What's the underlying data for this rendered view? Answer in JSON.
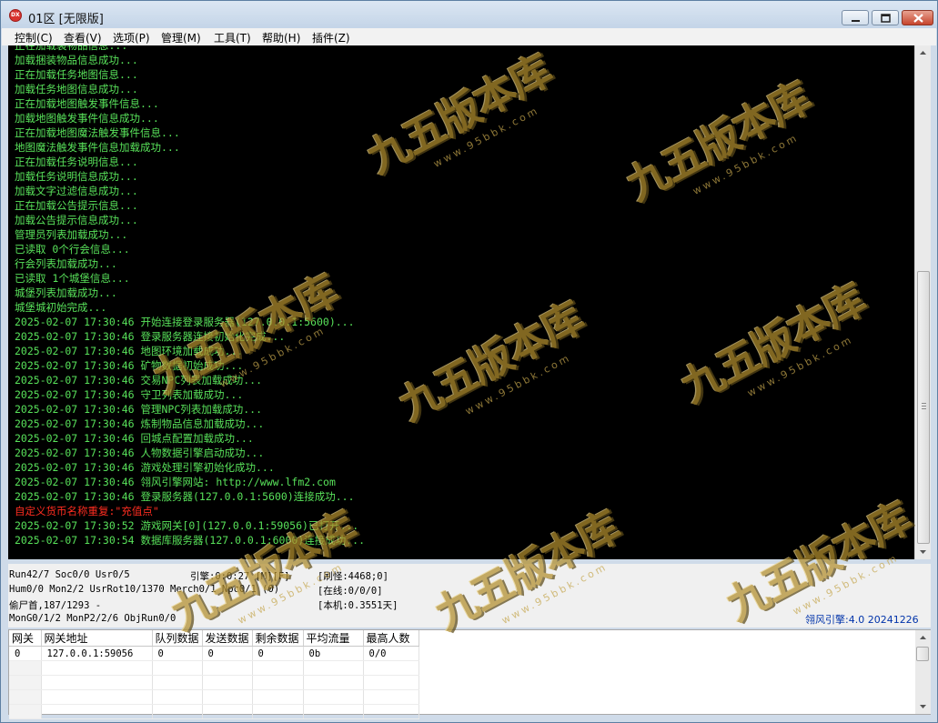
{
  "window": {
    "title": "01区 [无限版]"
  },
  "menu": [
    "控制(C)",
    "查看(V)",
    "选项(P)",
    "管理(M)",
    "工具(T)",
    "帮助(H)",
    "插件(Z)"
  ],
  "log": {
    "lines": [
      {
        "text": "正在加载装物品信息...",
        "style": "green"
      },
      {
        "text": "加载捆装物品信息成功...",
        "style": "green"
      },
      {
        "text": "正在加载任务地图信息...",
        "style": "green"
      },
      {
        "text": "加载任务地图信息成功...",
        "style": "green"
      },
      {
        "text": "正在加载地图触发事件信息...",
        "style": "green"
      },
      {
        "text": "加载地图触发事件信息成功...",
        "style": "green"
      },
      {
        "text": "正在加载地图魔法触发事件信息...",
        "style": "green"
      },
      {
        "text": "地图魔法触发事件信息加载成功...",
        "style": "green"
      },
      {
        "text": "正在加载任务说明信息...",
        "style": "green"
      },
      {
        "text": "加载任务说明信息成功...",
        "style": "green"
      },
      {
        "text": "加载文字过滤信息成功...",
        "style": "green"
      },
      {
        "text": "正在加载公告提示信息...",
        "style": "green"
      },
      {
        "text": "加载公告提示信息成功...",
        "style": "green"
      },
      {
        "text": "管理员列表加载成功...",
        "style": "green"
      },
      {
        "text": "已读取 0个行会信息...",
        "style": "green"
      },
      {
        "text": "行会列表加载成功...",
        "style": "green"
      },
      {
        "text": "已读取 1个城堡信息...",
        "style": "green"
      },
      {
        "text": "城堡列表加载成功...",
        "style": "green"
      },
      {
        "text": "城堡城初始完成...",
        "style": "green"
      },
      {
        "text": "2025-02-07 17:30:46 开始连接登录服务器(127.0.0.1:5600)...",
        "style": "green"
      },
      {
        "text": "2025-02-07 17:30:46 登录服务器连接初始化完成...",
        "style": "green"
      },
      {
        "text": "2025-02-07 17:30:46 地图环境加载成功...",
        "style": "green"
      },
      {
        "text": "2025-02-07 17:30:46 矿物数据初始成功...",
        "style": "green"
      },
      {
        "text": "2025-02-07 17:30:46 交易NPC列表加载成功...",
        "style": "green"
      },
      {
        "text": "2025-02-07 17:30:46 守卫列表加载成功...",
        "style": "green"
      },
      {
        "text": "2025-02-07 17:30:46 管理NPC列表加载成功...",
        "style": "green"
      },
      {
        "text": "2025-02-07 17:30:46 炼制物品信息加载成功...",
        "style": "green"
      },
      {
        "text": "2025-02-07 17:30:46 回城点配置加载成功...",
        "style": "green"
      },
      {
        "text": "2025-02-07 17:30:46 人物数据引擎启动成功...",
        "style": "green"
      },
      {
        "text": "2025-02-07 17:30:46 游戏处理引擎初始化成功...",
        "style": "green"
      },
      {
        "text": "2025-02-07 17:30:46 翎风引擎网站: http://www.lfm2.com",
        "style": "green"
      },
      {
        "text": "2025-02-07 17:30:46 登录服务器(127.0.0.1:5600)连接成功...",
        "style": "green"
      },
      {
        "text": "自定义货币名称重复:\"充值点\"",
        "style": "red"
      },
      {
        "text": "2025-02-07 17:30:52 游戏网关[0](127.0.0.1:59056)已打开...",
        "style": "green"
      },
      {
        "text": "2025-02-07 17:30:54 数据库服务器(127.0.0.1:6000)连接成功...",
        "style": "green"
      }
    ]
  },
  "status": {
    "run": "Run42/7 Soc0/0 Usr0/5",
    "engine_tick": "引擎:0:0:27 [M][F]",
    "refresh": "[刷怪:4468;0]",
    "hum": "Hum0/0 Mon2/2 UsrRot10/1370 Merch0/1 Npc0/1 (0)",
    "online": "[在线:0/0/0]",
    "thief": "偷尸首,187/1293 -",
    "machine": "[本机:0.3551天]",
    "mon": "MonG0/1/2 MonP2/2/6 ObjRun0/0",
    "engine_version": "翎风引擎:4.0 20241226"
  },
  "gateway_table": {
    "columns": [
      "网关",
      "网关地址",
      "队列数据",
      "发送数据",
      "剩余数据",
      "平均流量",
      "最高人数"
    ],
    "rows": [
      [
        "0",
        "127.0.0.1:59056",
        "0",
        "0",
        "0",
        "0b",
        "0/0"
      ]
    ],
    "empty_rows": 4
  },
  "watermark": {
    "main": "九五版本库",
    "sub": "www.95bbk.com"
  },
  "colors": {
    "log_text": "#58e15a",
    "log_error": "#ff2d20",
    "log_bg": "#000000",
    "engine_label": "#0033aa"
  }
}
